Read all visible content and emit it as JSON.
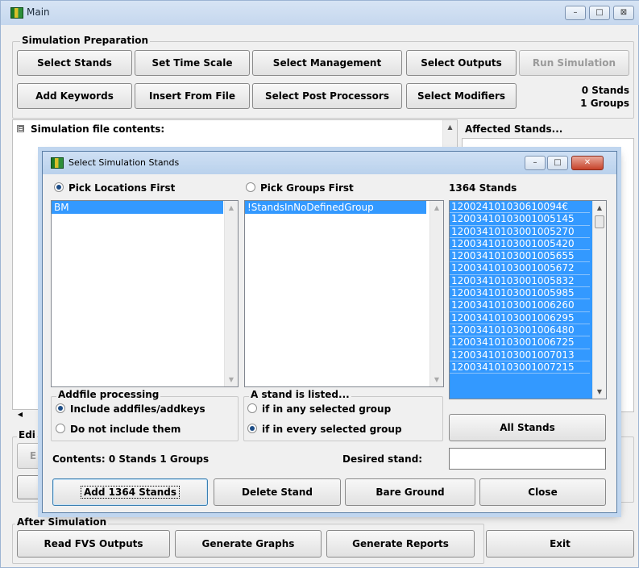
{
  "window": {
    "title": "Main",
    "min": "–",
    "max": "□",
    "close": "⊠",
    "icon": "forest-app-icon"
  },
  "sim_prep": {
    "legend": "Simulation Preparation",
    "buttons": [
      "Select Stands",
      "Set Time Scale",
      "Select Management",
      "Select Outputs",
      "Run Simulation",
      "Add Keywords",
      "Insert From File",
      "Select Post Processors",
      "Select Modifiers"
    ],
    "counts": {
      "stands": "0  Stands",
      "groups": "1  Groups"
    }
  },
  "main_panel": {
    "sim_file_label": "Simulation file contents:",
    "tree_toggle": "⊟",
    "affected_label": "Affected Stands...",
    "edit_legend": "Edi",
    "edit_btn": "E"
  },
  "after_sim": {
    "legend": "After Simulation",
    "buttons": [
      "Read FVS Outputs",
      "Generate Graphs",
      "Generate Reports",
      "Exit"
    ]
  },
  "dialog": {
    "title": "Select Simulation Stands",
    "icon": "forest-app-icon",
    "pick_locations": "Pick Locations First",
    "pick_groups": "Pick Groups First",
    "stand_count": "1364 Stands",
    "locations": [
      "BM"
    ],
    "groups": [
      "!StandsInNoDefinedGroup"
    ],
    "stands": [
      "120024101030610094€",
      "12003410103001005145",
      "12003410103001005270",
      "12003410103001005420",
      "12003410103001005655",
      "12003410103001005672",
      "12003410103001005832",
      "12003410103001005985",
      "12003410103001006260",
      "12003410103001006295",
      "12003410103001006480",
      "12003410103001006725",
      "12003410103001007013",
      "12003410103001007215"
    ],
    "addfile": {
      "legend": "Addfile processing",
      "opt1": "Include addfiles/addkeys",
      "opt2": "Do not include them"
    },
    "listed": {
      "legend": "A stand is listed...",
      "opt1": "if in any selected group",
      "opt2": "if in every selected group"
    },
    "all_stands": "All Stands",
    "contents": "Contents: 0 Stands 1 Groups",
    "desired_label": "Desired stand:",
    "desired_value": "",
    "buttons": {
      "add": "Add 1364 Stands",
      "delete": "Delete Stand",
      "bare": "Bare Ground",
      "close": "Close"
    },
    "state": {
      "pick": "locations",
      "addfile": "include",
      "listed": "every"
    }
  },
  "colors": {
    "selection": "#3399ff",
    "titlebar": "#c5d7ee"
  }
}
